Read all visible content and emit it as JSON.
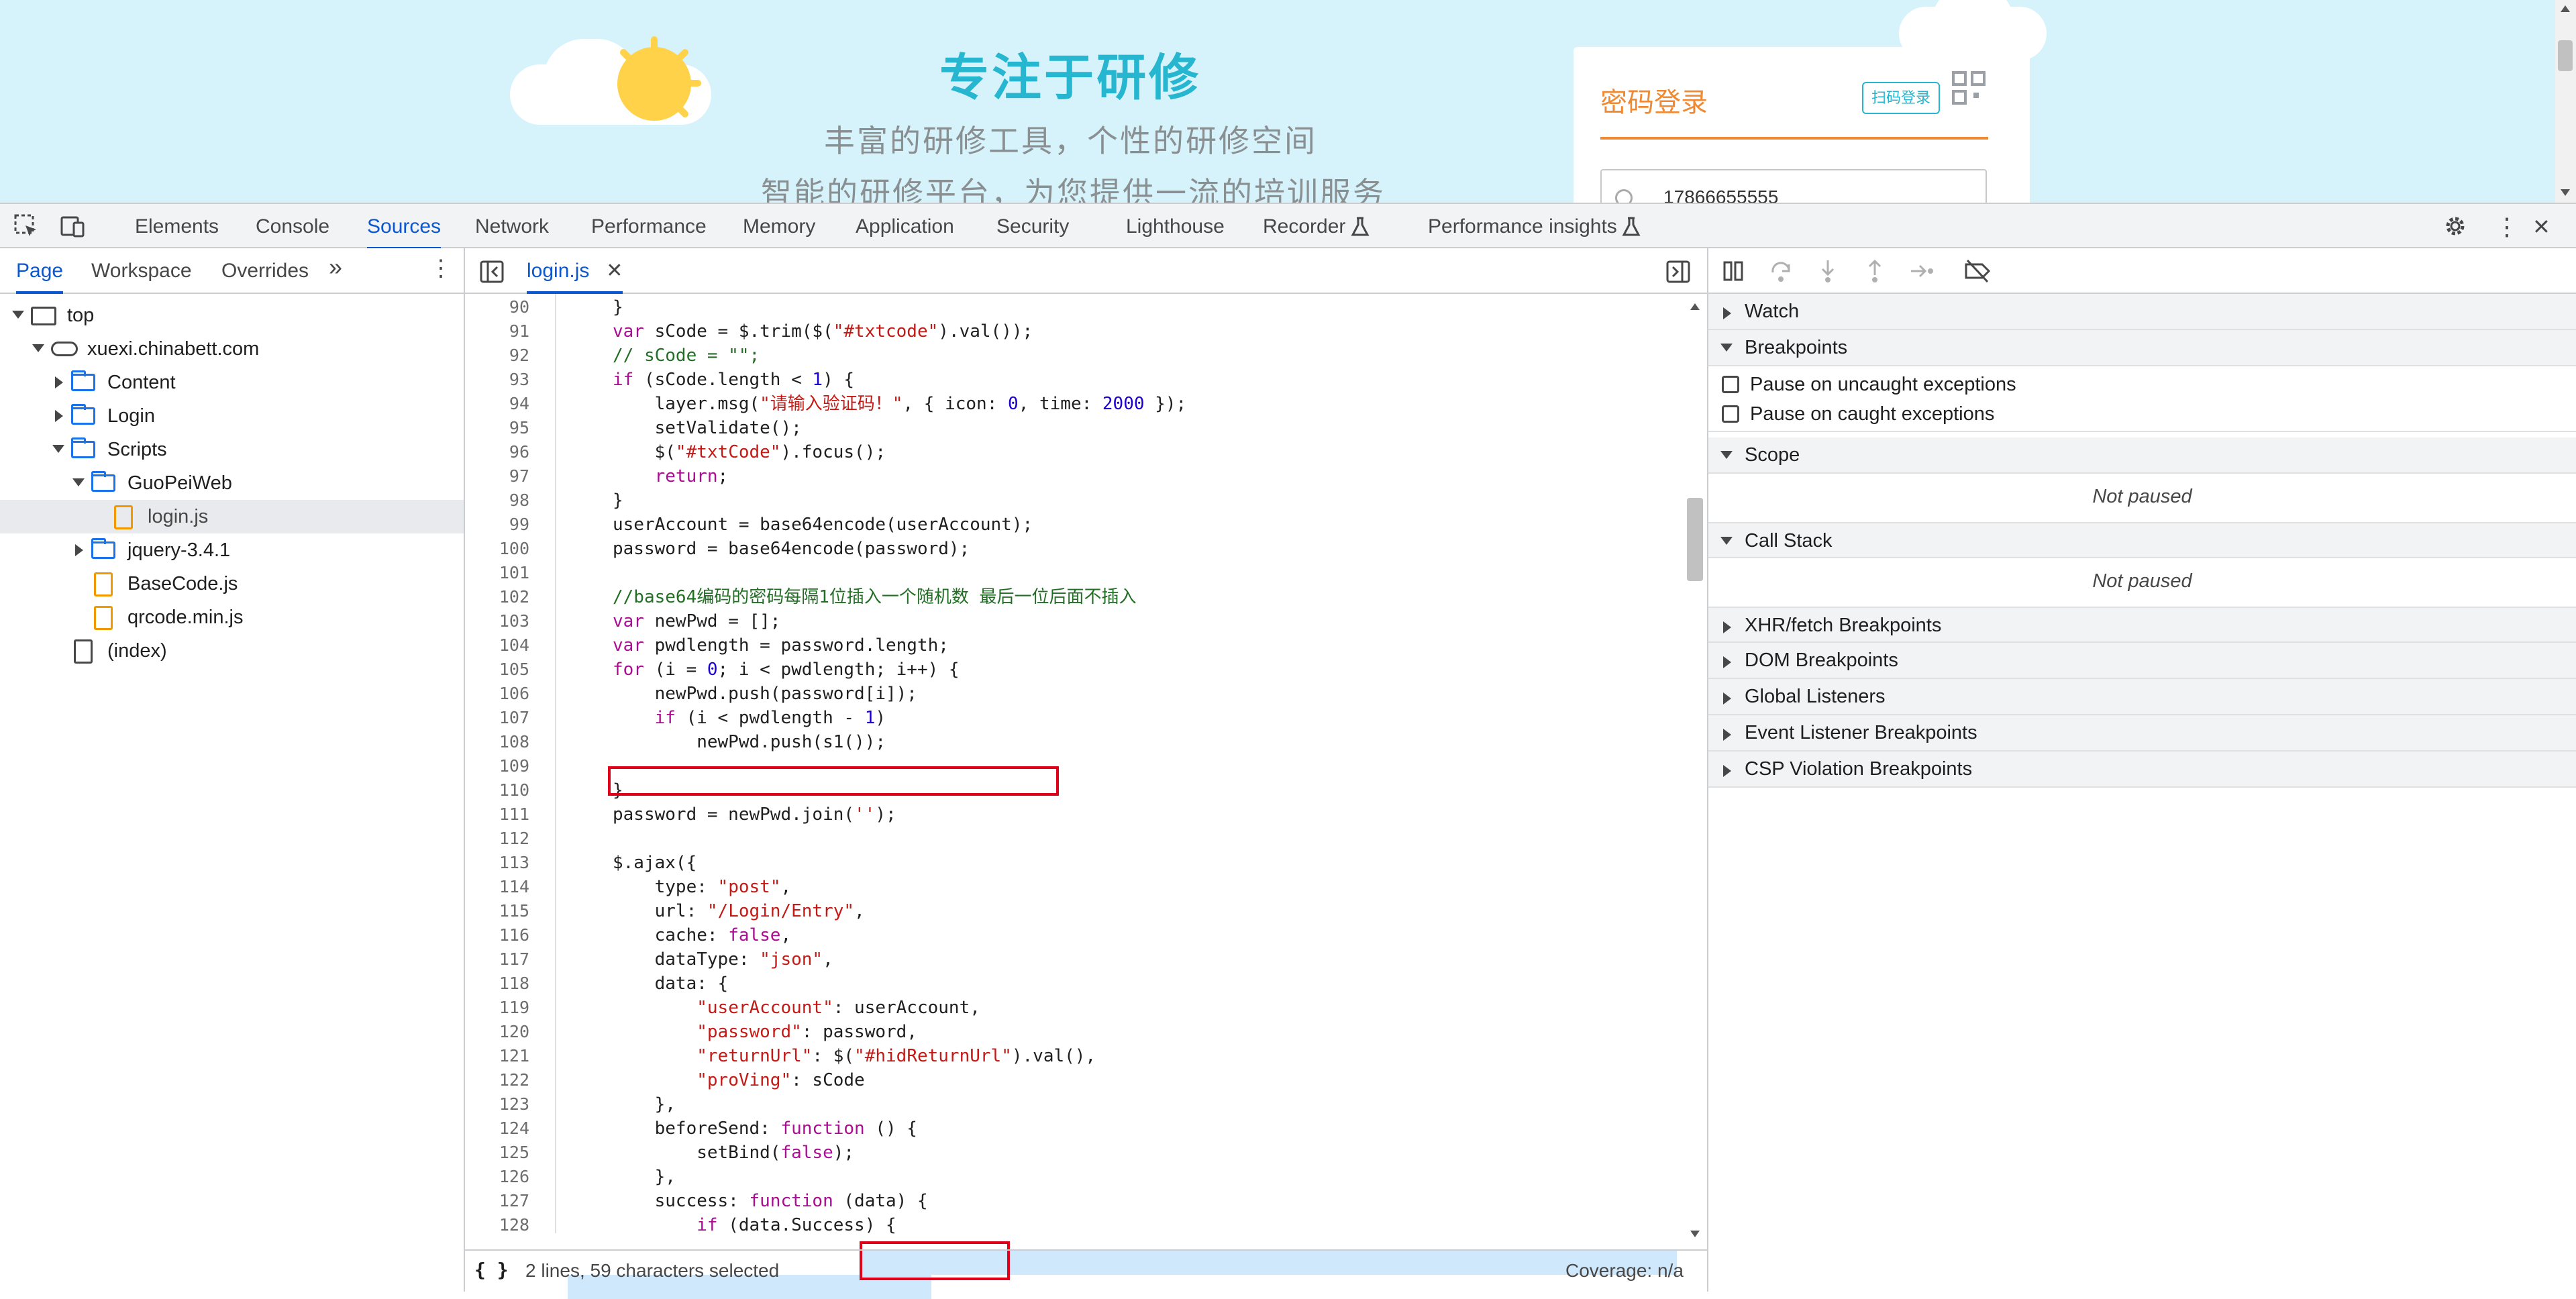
{
  "banner": {
    "title": "专注于研修",
    "subtitle1": "丰富的研修工具，个性的研修空间",
    "subtitle2": "智能的研修平台，为您提供一流的培训服务",
    "login_title": "密码登录",
    "scan_login": "扫码登录",
    "phone_value": "17866655555"
  },
  "devtools": {
    "tabs": [
      "Elements",
      "Console",
      "Sources",
      "Network",
      "Performance",
      "Memory",
      "Application",
      "Security",
      "Lighthouse",
      "Recorder",
      "Performance insights"
    ],
    "active_tab": "Sources"
  },
  "navigator": {
    "tabs": [
      "Page",
      "Workspace",
      "Overrides"
    ],
    "active_tab": "Page",
    "tree": [
      {
        "label": "top",
        "kind": "frame",
        "depth": 0,
        "expanded": true
      },
      {
        "label": "xuexi.chinabett.com",
        "kind": "domain",
        "depth": 1,
        "expanded": true
      },
      {
        "label": "Content",
        "kind": "folder",
        "depth": 2,
        "expanded": false
      },
      {
        "label": "Login",
        "kind": "folder",
        "depth": 2,
        "expanded": false
      },
      {
        "label": "Scripts",
        "kind": "folder",
        "depth": 2,
        "expanded": true
      },
      {
        "label": "GuoPeiWeb",
        "kind": "folder",
        "depth": 3,
        "expanded": true
      },
      {
        "label": "login.js",
        "kind": "file",
        "depth": 4,
        "selected": true
      },
      {
        "label": "jquery-3.4.1",
        "kind": "folder",
        "depth": 3,
        "expanded": false
      },
      {
        "label": "BaseCode.js",
        "kind": "file",
        "depth": 3
      },
      {
        "label": "qrcode.min.js",
        "kind": "file",
        "depth": 3
      },
      {
        "label": "(index)",
        "kind": "doc",
        "depth": 2
      }
    ]
  },
  "editor": {
    "file_tab": "login.js",
    "close_glyph": "✕",
    "line_numbers": [
      "90",
      "91",
      "92",
      "93",
      "94",
      "95",
      "96",
      "97",
      "98",
      "99",
      "100",
      "101",
      "102",
      "103",
      "104",
      "105",
      "106",
      "107",
      "108",
      "109",
      "110",
      "111",
      "112",
      "113",
      "114",
      "115",
      "116",
      "117",
      "118",
      "119",
      "120",
      "121",
      "122",
      "123",
      "124",
      "125",
      "126",
      "127",
      "128"
    ],
    "lines": [
      "}",
      "var sCode = $.trim($(\"#txtcode\").val());",
      "// sCode = \"\";",
      "if (sCode.length < 1) {",
      "    layer.msg(\"请输入验证码！\", { icon: 0, time: 2000 });",
      "    setValidate();",
      "    $(\"#txtCode\").focus();",
      "    return;",
      "}",
      "userAccount = base64encode(userAccount);",
      "password = base64encode(password);",
      "",
      "//base64编码的密码每隔1位插入一个随机数 最后一位后面不插入",
      "var newPwd = [];",
      "var pwdlength = password.length;",
      "for (i = 0; i < pwdlength; i++) {",
      "    newPwd.push(password[i]);",
      "    if (i < pwdlength - 1)",
      "        newPwd.push(s1());",
      "",
      "}",
      "password = newPwd.join('');",
      "",
      "$.ajax({",
      "    type: \"post\",",
      "    url: \"/Login/Entry\",",
      "    cache: false,",
      "    dataType: \"json\",",
      "    data: {",
      "        \"userAccount\": userAccount,",
      "        \"password\": password,",
      "        \"returnUrl\": $(\"#hidReturnUrl\").val(),",
      "        \"proVing\": sCode",
      "    },",
      "    beforeSend: function () {",
      "        setBind(false);",
      "    },",
      "    success: function (data) {",
      "        if (data.Success) {"
    ],
    "status_selection": "2 lines, 59 characters selected",
    "status_coverage": "Coverage: n/a",
    "status_braces": "{ }"
  },
  "debugger": {
    "sections": [
      {
        "label": "Watch",
        "expanded": false
      },
      {
        "label": "Breakpoints",
        "expanded": true
      },
      {
        "label": "Scope",
        "expanded": true
      },
      {
        "label": "Call Stack",
        "expanded": true
      },
      {
        "label": "XHR/fetch Breakpoints",
        "expanded": false
      },
      {
        "label": "DOM Breakpoints",
        "expanded": false
      },
      {
        "label": "Global Listeners",
        "expanded": false
      },
      {
        "label": "Event Listener Breakpoints",
        "expanded": false
      },
      {
        "label": "CSP Violation Breakpoints",
        "expanded": false
      }
    ],
    "pause_uncaught": "Pause on uncaught exceptions",
    "pause_caught": "Pause on caught exceptions",
    "scope_text": "Not paused",
    "callstack_text": "Not paused"
  },
  "colors": {
    "accent": "#0b57d0",
    "highlight_box": "#e0001a",
    "selection": "#cfe8fc",
    "banner_bg": "#d6f3fb",
    "brand_title": "#26b6cf",
    "login_orange": "#f08a32"
  },
  "icons": {
    "more_tabs": "»",
    "kebab": "⋮",
    "close": "✕"
  }
}
